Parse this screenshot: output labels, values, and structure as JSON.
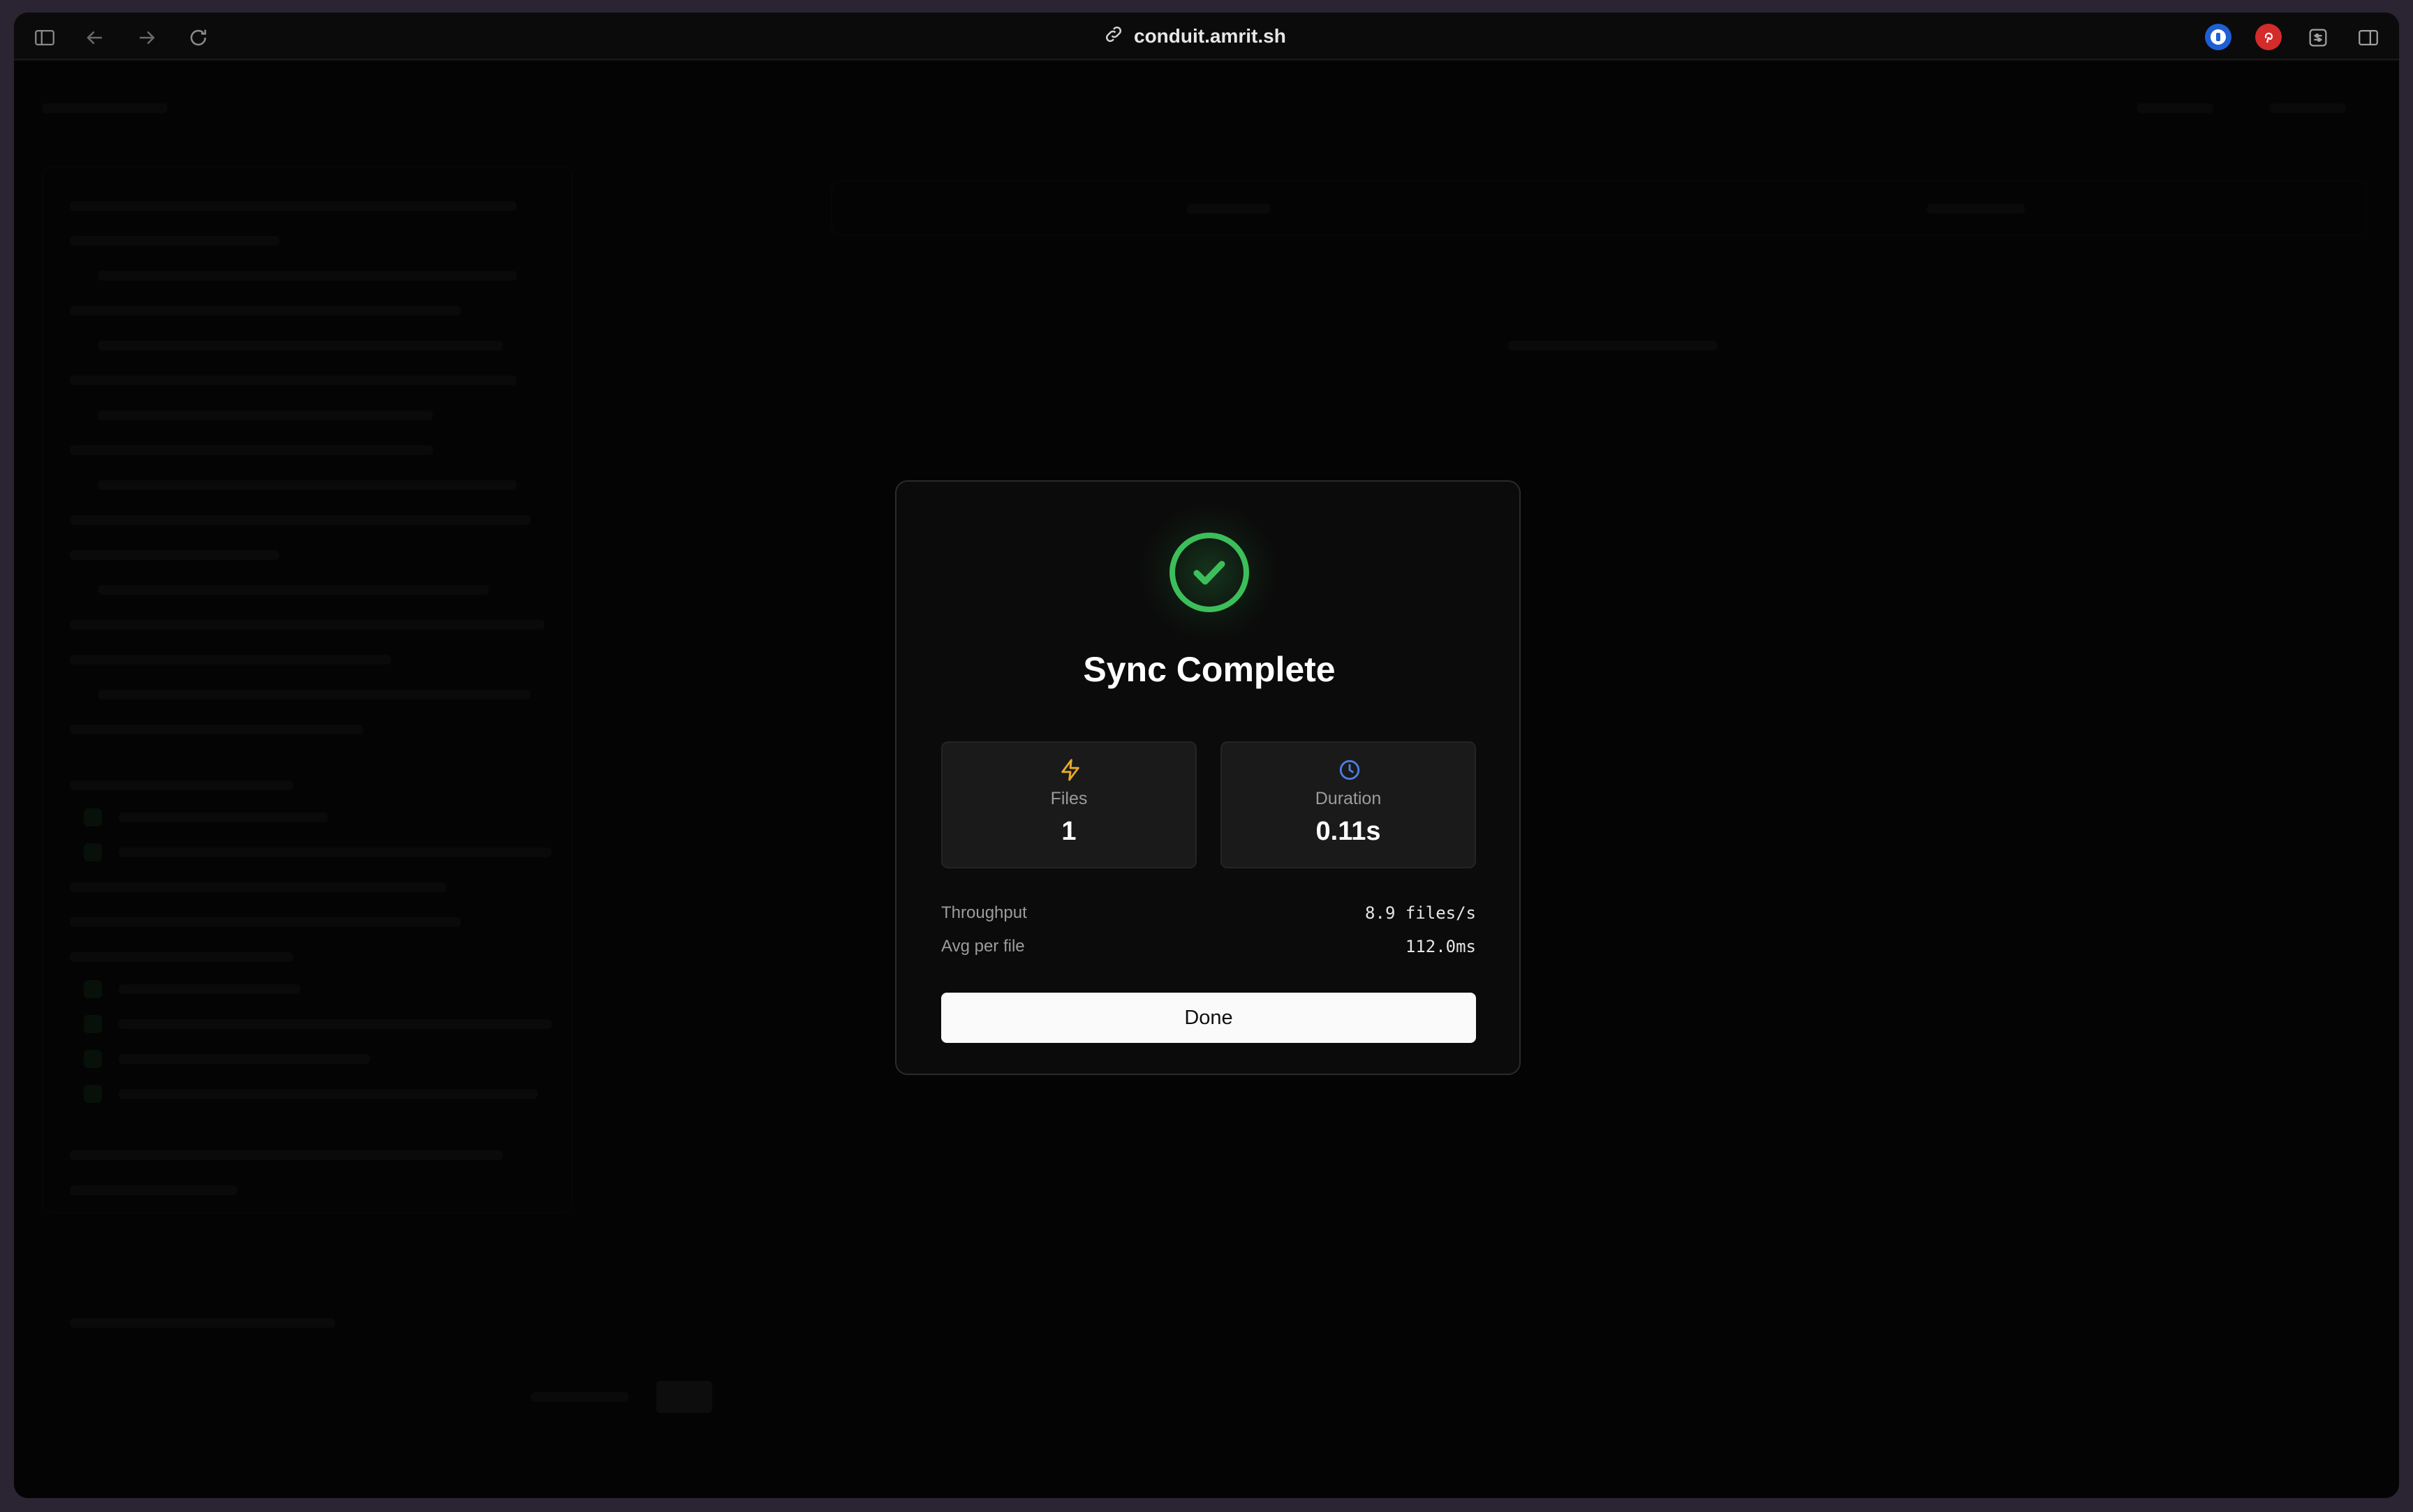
{
  "browser": {
    "url": "conduit.amrit.sh"
  },
  "dialog": {
    "title": "Sync Complete",
    "stats": [
      {
        "label": "Files",
        "value": "1",
        "icon": "lightning-icon",
        "color": "#e8a92b"
      },
      {
        "label": "Duration",
        "value": "0.11s",
        "icon": "clock-icon",
        "color": "#4f7ee8"
      }
    ],
    "metrics": [
      {
        "label": "Throughput",
        "value": "8.9 files/s"
      },
      {
        "label": "Avg per file",
        "value": "112.0ms"
      }
    ],
    "done_label": "Done",
    "accent": "#3cbf5a"
  }
}
